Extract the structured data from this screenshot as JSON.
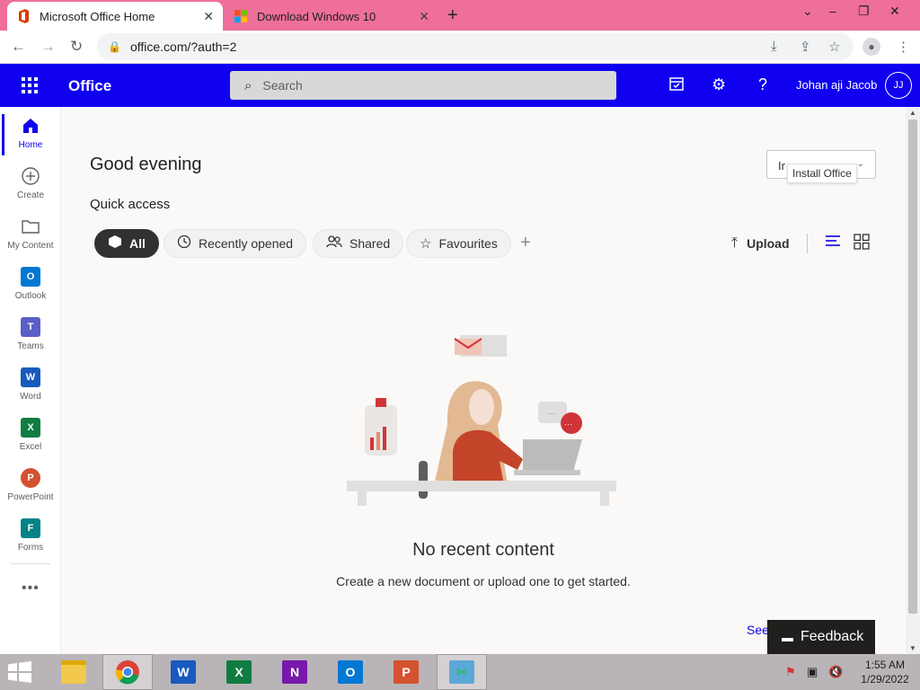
{
  "browser": {
    "tabs": [
      {
        "title": "Microsoft Office Home",
        "active": true,
        "close": "✕"
      },
      {
        "title": "Download Windows 10",
        "active": false,
        "close": "✕"
      }
    ],
    "new_tab": "+",
    "window_controls": [
      "⌄",
      "–",
      "❐",
      "✕"
    ],
    "url": "office.com/?auth=2",
    "nav": {
      "back": "←",
      "forward": "→",
      "reload": "↻"
    }
  },
  "office_header": {
    "brand": "Office",
    "search_placeholder": "Search",
    "user_name": "Johan aji Jacob",
    "avatar_initials": "JJ",
    "accent_color": "#0f00f0"
  },
  "rail": {
    "items": [
      {
        "label": "Home",
        "icon": "home-icon"
      },
      {
        "label": "Create",
        "icon": "create-icon"
      },
      {
        "label": "My Content",
        "icon": "folder-icon"
      },
      {
        "label": "Outlook",
        "icon": "outlook-icon"
      },
      {
        "label": "Teams",
        "icon": "teams-icon"
      },
      {
        "label": "Word",
        "icon": "word-icon"
      },
      {
        "label": "Excel",
        "icon": "excel-icon"
      },
      {
        "label": "PowerPoint",
        "icon": "powerpoint-icon"
      },
      {
        "label": "Forms",
        "icon": "forms-icon"
      }
    ],
    "more": "•••"
  },
  "main": {
    "greeting": "Good evening",
    "install_button_partial": "Ir",
    "install_tooltip": "Install Office",
    "quick_access_title": "Quick access",
    "filters": [
      {
        "label": "All",
        "selected": true
      },
      {
        "label": "Recently opened",
        "selected": false
      },
      {
        "label": "Shared",
        "selected": false
      },
      {
        "label": "Favourites",
        "selected": false
      }
    ],
    "upload_label": "Upload",
    "empty_title": "No recent content",
    "empty_subtitle": "Create a new document or upload one to get started.",
    "see_more": "See",
    "feedback_label": "Feedback"
  },
  "taskbar": {
    "apps": [
      "file-explorer",
      "chrome",
      "word",
      "excel",
      "onenote",
      "outlook",
      "powerpoint",
      "snipping-tool"
    ],
    "time": "1:55 AM",
    "date": "1/29/2022"
  }
}
